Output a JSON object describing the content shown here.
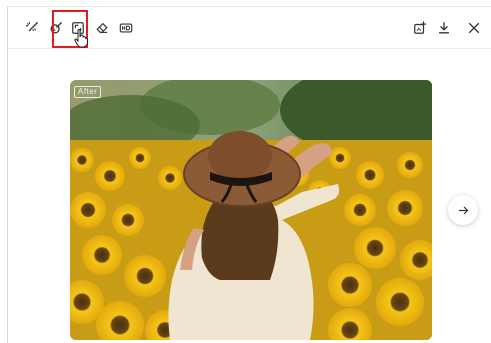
{
  "toolbar": {
    "left_tools": [
      {
        "name": "magic-wand-icon"
      },
      {
        "name": "retouch-icon"
      },
      {
        "name": "crop-expand-icon",
        "highlighted": true
      },
      {
        "name": "eraser-icon"
      },
      {
        "name": "hd-icon"
      }
    ],
    "right_tools": [
      {
        "name": "add-image-icon"
      },
      {
        "name": "download-icon"
      },
      {
        "name": "close-icon"
      }
    ]
  },
  "image": {
    "badge": "After"
  },
  "navigation": {
    "next_icon": "arrow-right-icon"
  },
  "colors": {
    "highlight": "#e11b22",
    "icon": "#333333",
    "sunflower": "#f2c21b",
    "sunflower_center": "#5a3a12",
    "hat": "#8b5a36",
    "dress": "#f0e7d4"
  }
}
